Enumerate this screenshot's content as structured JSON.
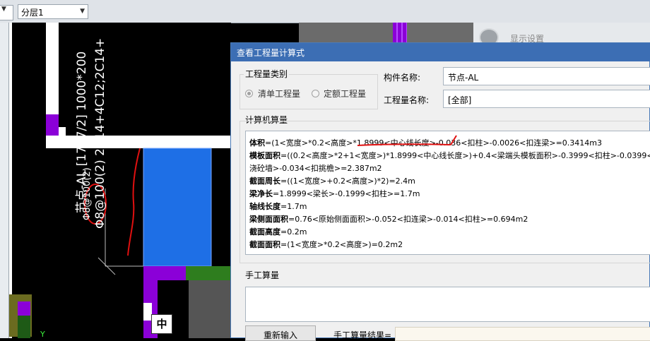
{
  "toolbar": {
    "layer_select_value": "分层1"
  },
  "canvas": {
    "annotation_lines": [
      "节点-AL [1777/2] 1000*200",
      "Φ8@100(2) 2C14+4C12;2C14+",
      "Φ8@100(2)"
    ],
    "zhong_label": "中",
    "axis_label": "Y"
  },
  "display_panel": {
    "title": "显示设置"
  },
  "dialog": {
    "title": "查看工程量计算式",
    "quantity_type": {
      "group_label": "工程量类别",
      "options": [
        "清单工程量",
        "定额工程量"
      ],
      "selected": "清单工程量"
    },
    "component_name_label": "构件名称:",
    "component_name_value": "节点-AL",
    "quantity_name_label": "工程量名称:",
    "quantity_name_value": "[全部]",
    "computer_section_label": "计算机算量",
    "formulas": [
      {
        "name": "体积",
        "expr": "=(1<宽度>*0.2<高度>*1.8999<中心线长度>-0.036<扣柱>-0.0026<扣连梁>=0.3414m3"
      },
      {
        "name": "模板面积",
        "expr": "=((0.2<高度>*2+1<宽度>)*1.8999<中心线长度>)+0.4<梁端头模板面积>-0.3999<扣柱>-0.0399<扣"
      },
      {
        "name": "",
        "expr": "浇砼墙>-0.034<扣挑檐>=2.387m2"
      },
      {
        "name": "截面周长",
        "expr": "=((1<宽度>+0.2<高度>)*2)=2.4m"
      },
      {
        "name": "梁净长",
        "expr": "=1.8999<梁长>-0.1999<扣柱>=1.7m"
      },
      {
        "name": "轴线长度",
        "expr": "=1.7m"
      },
      {
        "name": "梁侧面面积",
        "expr": "=0.76<原始侧面面积>-0.052<扣连梁>-0.014<扣柱>=0.694m2"
      },
      {
        "name": "截面高度",
        "expr": "=0.2m"
      },
      {
        "name": "截面面积",
        "expr": "=(1<宽度>*0.2<高度>)=0.2m2"
      }
    ],
    "manual_section_label": "手工算量",
    "reenter_button": "重新输入",
    "manual_result_label": "手工算量结果="
  }
}
